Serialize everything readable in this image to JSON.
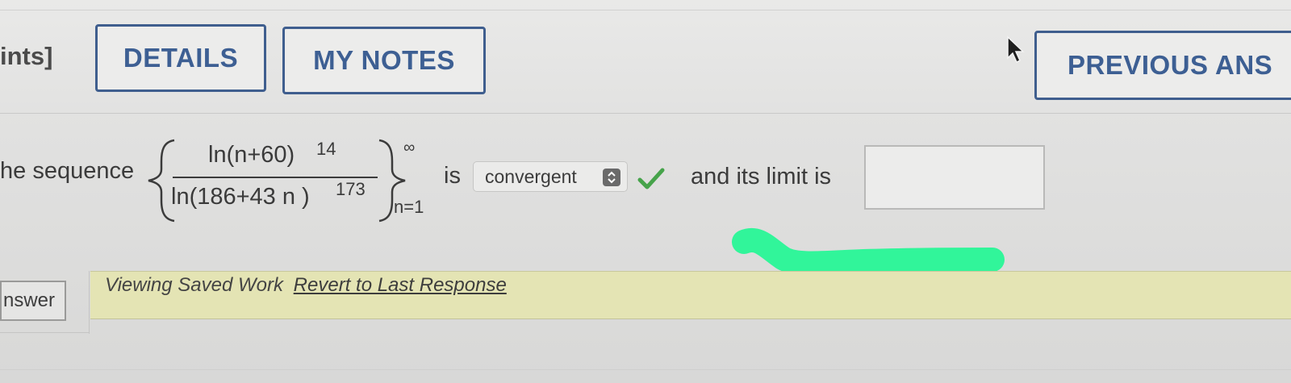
{
  "header": {
    "points_label": "ints]",
    "details_label": "DETAILS",
    "my_notes_label": "MY NOTES",
    "previous_answers_label": "PREVIOUS ANS"
  },
  "question": {
    "prefix": "he sequence",
    "numerator": "ln(n+60)",
    "numerator_exp": "14",
    "denominator": "ln(186+43 n )",
    "denominator_exp": "173",
    "upper_limit": "∞",
    "lower_limit": "n=1",
    "is_label": "is",
    "select_value": "convergent",
    "limit_label": "and its limit is",
    "answer_value": ""
  },
  "status": {
    "viewing_saved": "Viewing Saved Work",
    "revert_link": "Revert to Last Response"
  },
  "side_tab": {
    "label": "nswer"
  },
  "icons": {
    "cursor": "mouse-pointer-icon",
    "check": "checkmark-icon",
    "select_arrows": "chevron-updown-icon"
  },
  "colors": {
    "button_border": "#3f5e8e",
    "button_text": "#3d5f93",
    "check_green": "#46a34a",
    "highlight_green": "#31f59a",
    "saved_bar": "#e4e4b4"
  }
}
